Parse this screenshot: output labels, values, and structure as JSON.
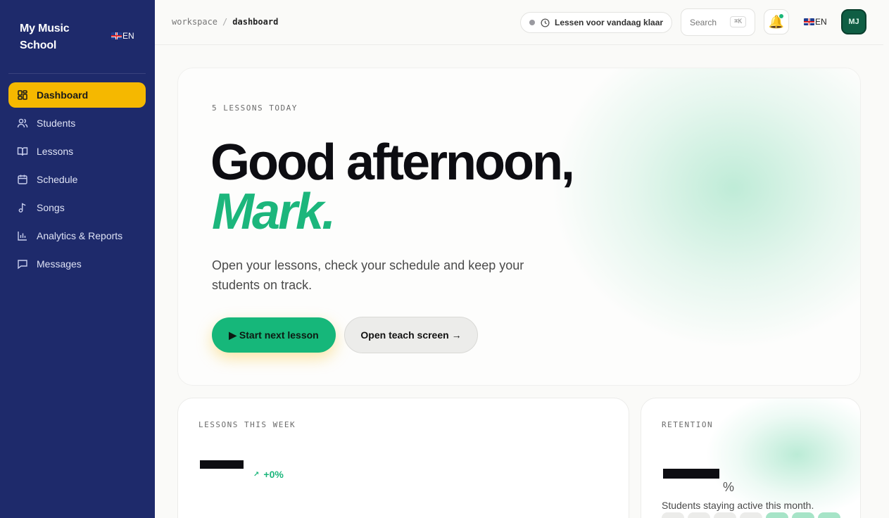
{
  "sidebar": {
    "brand": "My Music School",
    "lang": "EN",
    "items": [
      {
        "label": "Dashboard",
        "icon": "dashboard-icon"
      },
      {
        "label": "Students",
        "icon": "users-icon"
      },
      {
        "label": "Lessons",
        "icon": "book-icon"
      },
      {
        "label": "Schedule",
        "icon": "calendar-icon"
      },
      {
        "label": "Songs",
        "icon": "music-note-icon"
      },
      {
        "label": "Analytics & Reports",
        "icon": "bar-chart-icon"
      },
      {
        "label": "Messages",
        "icon": "message-icon"
      }
    ]
  },
  "topbar": {
    "breadcrumb_root": "workspace",
    "breadcrumb_sep": "/",
    "breadcrumb_current": "dashboard",
    "status_text": "Lessen voor vandaag klaar",
    "search_placeholder": "Search",
    "search_shortcut": "⌘K",
    "lang": "EN",
    "avatar_initials": "MJ"
  },
  "hero": {
    "eyebrow": "5 LESSONS TODAY",
    "greeting": "Good afternoon,",
    "name": "Mark.",
    "lead": "Open your lessons, check your schedule and keep your students on track.",
    "primary_button": "▶ Start next lesson",
    "secondary_button": "Open teach screen →"
  },
  "cards": {
    "week": {
      "label": "LESSONS THIS WEEK",
      "delta": "+0%"
    },
    "retention": {
      "label": "RETENTION",
      "unit": "%",
      "subtitle": "Students staying active this month."
    }
  },
  "colors": {
    "sidebar": "#1e2a6b",
    "accent_yellow": "#f5b800",
    "accent_green": "#1cb67c"
  }
}
